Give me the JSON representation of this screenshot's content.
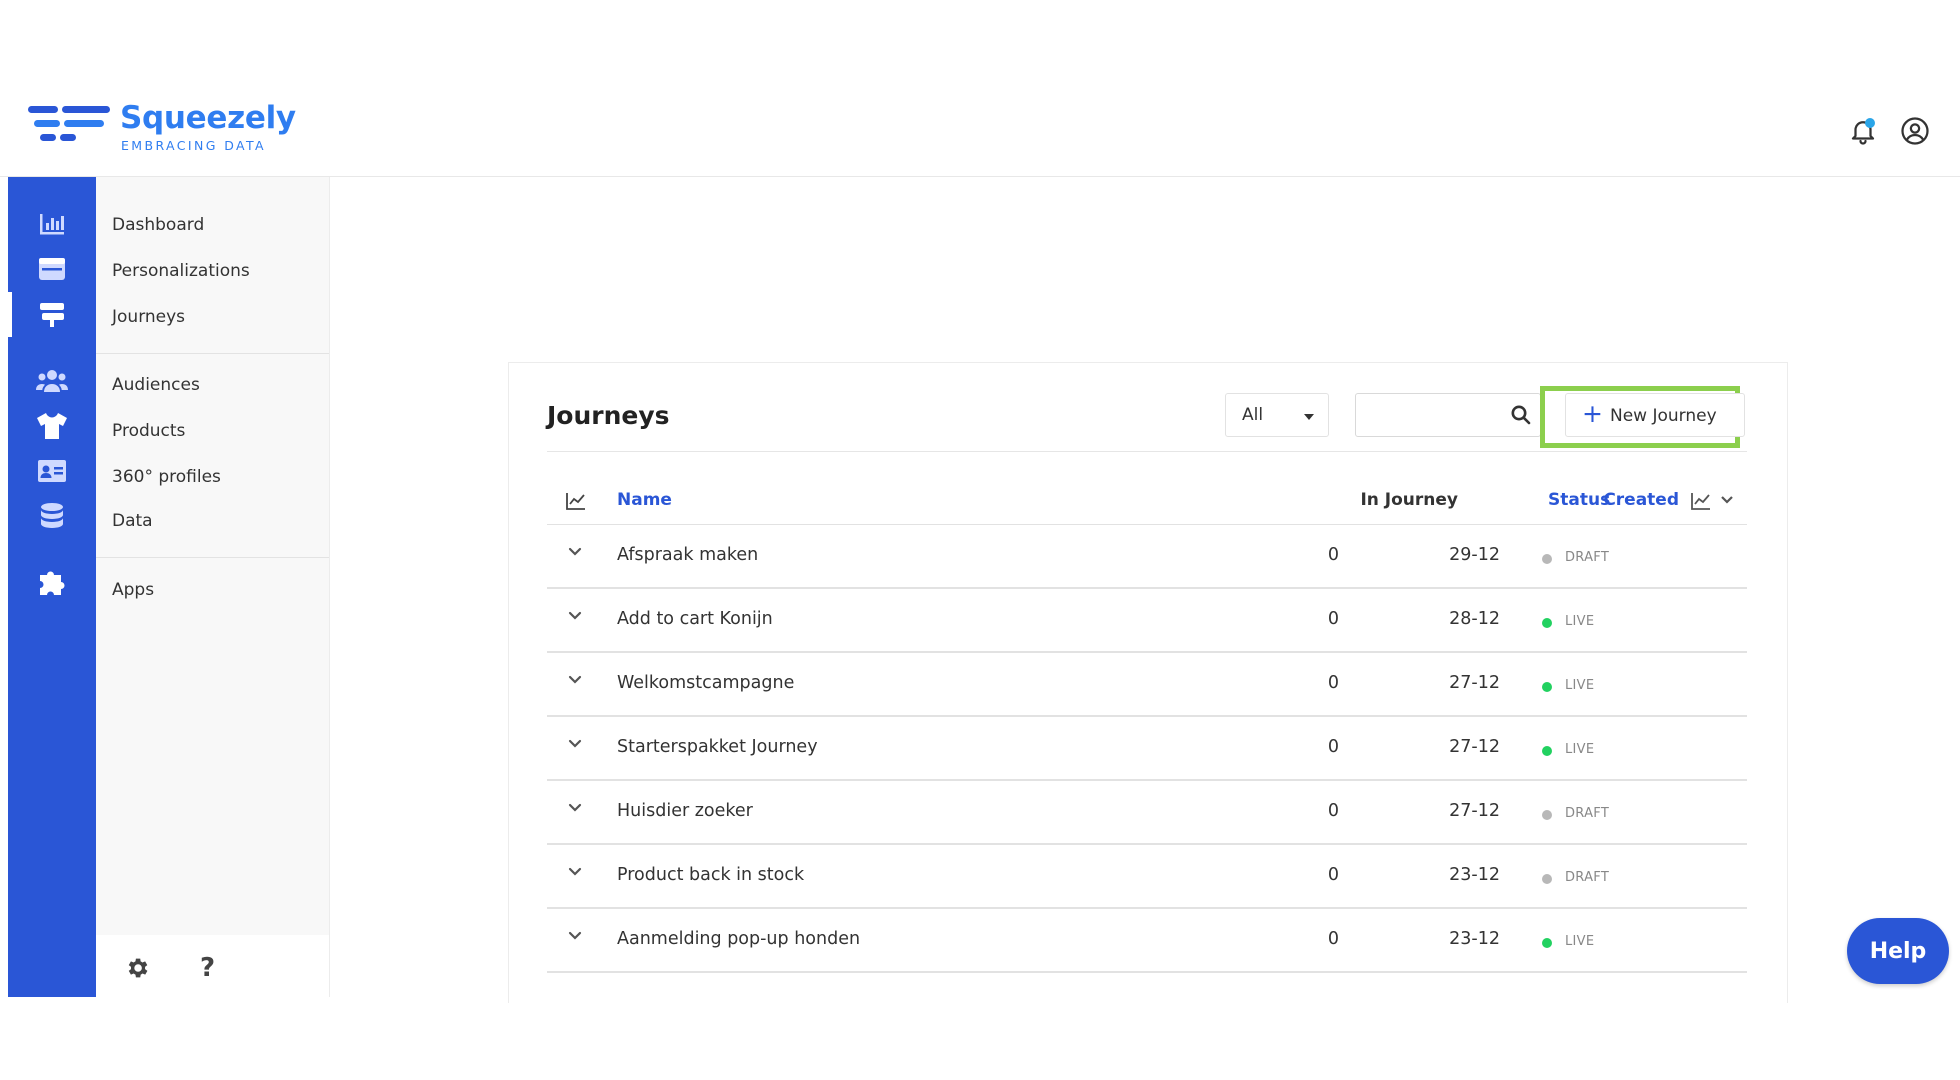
{
  "brand": {
    "name": "Squeezely",
    "tagline": "EMBRACING DATA",
    "accent": "#2a56d6",
    "logo_color": "#2f7df0"
  },
  "header": {
    "icons": [
      "bell-icon",
      "user-circle-icon"
    ]
  },
  "rail": {
    "icons": [
      "chart-icon",
      "window-icon",
      "signpost-icon",
      "users-icon",
      "shirt-icon",
      "id-card-icon",
      "database-icon",
      "puzzle-icon"
    ],
    "active": "signpost-icon"
  },
  "nav": {
    "group1": [
      "Dashboard",
      "Personalizations",
      "Journeys"
    ],
    "group2": [
      "Audiences",
      "Products",
      "360° profiles",
      "Data"
    ],
    "group3": [
      "Apps"
    ],
    "active": "Journeys"
  },
  "footer": {
    "icons": [
      "gear-icon",
      "question-icon"
    ]
  },
  "page": {
    "title": "Journeys",
    "filter": {
      "selected": "All"
    },
    "search": {
      "value": ""
    },
    "new_button": "New Journey"
  },
  "table": {
    "columns": {
      "name": "Name",
      "in_journey": "In Journey",
      "created": "Created",
      "status": "Status"
    },
    "rows": [
      {
        "name": "Afspraak maken",
        "in_journey": "0",
        "created": "29-12",
        "status": "DRAFT"
      },
      {
        "name": "Add to cart Konijn",
        "in_journey": "0",
        "created": "28-12",
        "status": "LIVE"
      },
      {
        "name": "Welkomstcampagne",
        "in_journey": "0",
        "created": "27-12",
        "status": "LIVE"
      },
      {
        "name": "Starterspakket Journey",
        "in_journey": "0",
        "created": "27-12",
        "status": "LIVE"
      },
      {
        "name": "Huisdier zoeker",
        "in_journey": "0",
        "created": "27-12",
        "status": "DRAFT"
      },
      {
        "name": "Product back in stock",
        "in_journey": "0",
        "created": "23-12",
        "status": "DRAFT"
      },
      {
        "name": "Aanmelding pop-up honden",
        "in_journey": "0",
        "created": "23-12",
        "status": "LIVE"
      }
    ],
    "status_colors": {
      "LIVE": "#22d160",
      "DRAFT": "#b8b8b8"
    }
  },
  "help": {
    "label": "Help"
  }
}
